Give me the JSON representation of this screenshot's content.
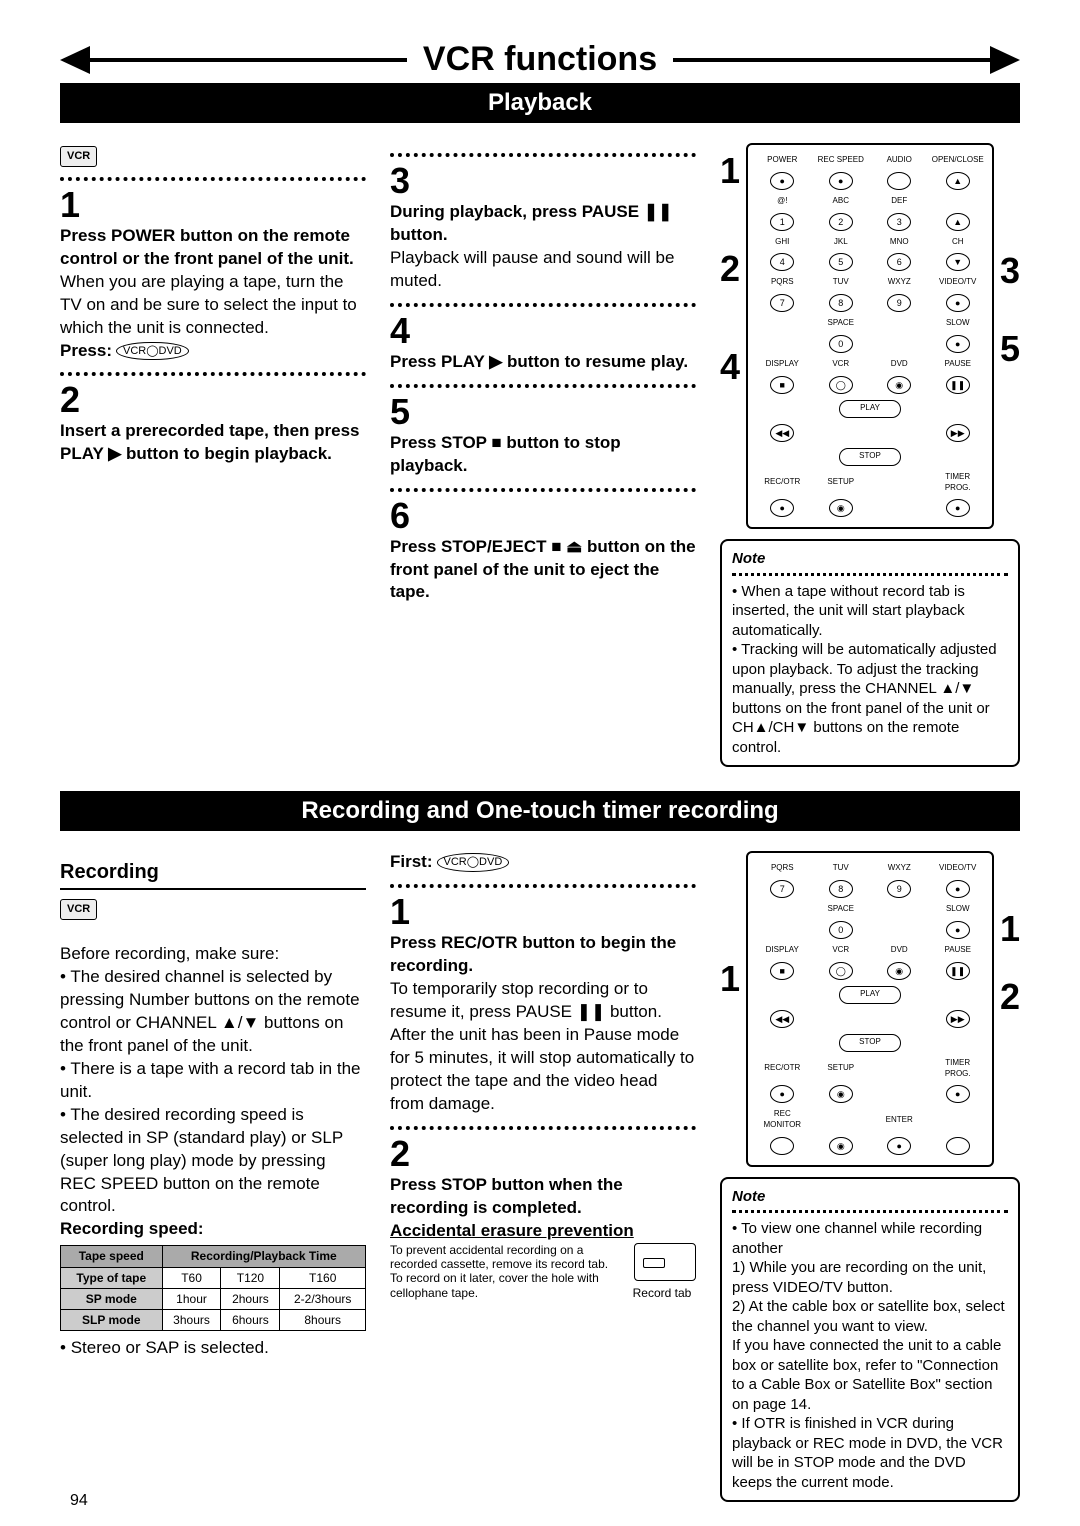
{
  "title": "VCR functions",
  "sub1": "Playback",
  "sub2": "Recording and One-touch timer recording",
  "vcr_badge": "VCR",
  "playback": {
    "s1_h": "Press POWER button on the remote control or the front panel of the unit.",
    "s1_b": "When you are playing a tape, turn the TV on and be sure to select the input to which the unit is connected.",
    "s1_press": "Press:",
    "s2_h": "Insert a prerecorded tape, then press PLAY ▶ button to begin playback.",
    "s3_h": "During playback, press PAUSE ❚❚ button.",
    "s3_b": "Playback will pause and sound will be muted.",
    "s4_h": "Press PLAY ▶ button to resume play.",
    "s5_h": "Press STOP ■ button to stop playback.",
    "s6_h": "Press STOP/EJECT ■ ⏏ button on the front panel of the unit to eject the tape."
  },
  "note1": {
    "head": "Note",
    "b1": "When a tape without record tab is inserted, the unit will start playback automatically.",
    "b2": "Tracking will be automatically adjusted upon playback. To adjust the tracking manually, press the CHANNEL ▲/▼ buttons on the front panel of the unit or CH▲/CH▼ buttons on the remote control."
  },
  "recording": {
    "head": "Recording",
    "intro": "Before recording, make sure:",
    "p1": "The desired channel is selected by pressing Number buttons on the remote control or CHANNEL ▲/▼ buttons on the front panel of the unit.",
    "p2": "There is a tape with a record tab in the unit.",
    "p3": "The desired recording speed is selected in SP (standard play) or SLP (super long play) mode by pressing REC SPEED button on the remote control.",
    "speedhead": "Recording speed:",
    "table": {
      "h1": "Tape speed",
      "h2": "Recording/Playback Time",
      "r1c0": "Type of tape",
      "r1c1": "T60",
      "r1c2": "T120",
      "r1c3": "T160",
      "r2c0": "SP mode",
      "r2c1": "1hour",
      "r2c2": "2hours",
      "r2c3": "2-2/3hours",
      "r3c0": "SLP mode",
      "r3c1": "3hours",
      "r3c2": "6hours",
      "r3c3": "8hours"
    },
    "stereo": "Stereo or SAP is selected.",
    "first": "First:",
    "s1_h": "Press REC/OTR button to begin the recording.",
    "s1_b": "To temporarily stop recording or to resume it, press PAUSE ❚❚ button. After the unit has been in Pause mode for 5 minutes, it will stop automatically to protect the tape and the video head from damage.",
    "s2_h": "Press STOP button when the recording is completed.",
    "acc_head": "Accidental erasure prevention",
    "acc_body": "To prevent accidental recording on a recorded cassette, remove its record tab. To record on it later, cover the hole with cellophane tape.",
    "acc_label": "Record tab"
  },
  "note2": {
    "head": "Note",
    "b1": "To view one channel while recording another",
    "b1a": "1) While you are recording on the unit, press VIDEO/TV button.",
    "b1b": "2) At the cable box or satellite box, select the channel you want to view.",
    "b1c": "If you have connected the unit to a cable box or satellite box, refer to \"Connection to a Cable Box or Satellite Box\" section on page 14.",
    "b2": "If OTR is finished in VCR during playback or REC mode in DVD, the VCR will be in STOP mode and the DVD keeps the current mode."
  },
  "remote_labels": {
    "power": "POWER",
    "recspeed": "REC SPEED",
    "audio": "AUDIO",
    "openclose": "OPEN/CLOSE",
    "abc": "ABC",
    "def": "DEF",
    "ghi": "GHI",
    "jkl": "JKL",
    "mno": "MNO",
    "ch": "CH",
    "pqrs": "PQRS",
    "tuv": "TUV",
    "wxyz": "WXYZ",
    "videotv": "VIDEO/TV",
    "space": "SPACE",
    "slow": "SLOW",
    "display": "DISPLAY",
    "vcr": "VCR",
    "dvd": "DVD",
    "pause": "PAUSE",
    "play": "PLAY",
    "stop": "STOP",
    "recotr": "REC/OTR",
    "setup": "SETUP",
    "timer": "TIMER PROG.",
    "recmon": "REC MONITOR",
    "enter": "ENTER"
  },
  "indices": {
    "i1": "1",
    "i2": "2",
    "i3": "3",
    "i4": "4",
    "i5": "5"
  },
  "pagenum": "94"
}
